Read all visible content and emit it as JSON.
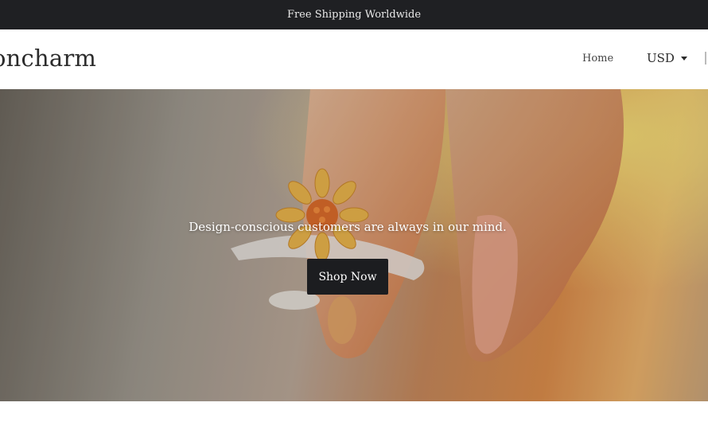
{
  "announcement": {
    "text": "Free Shipping Worldwide"
  },
  "header": {
    "logo_text": "oncharm",
    "nav": {
      "home_label": "Home"
    },
    "currency": {
      "selected": "USD",
      "icon": "chevron-down-icon"
    }
  },
  "hero": {
    "tagline": "Design-conscious customers are always in our mind.",
    "cta_label": "Shop Now",
    "image_subject": "sunflower-ring-on-finger",
    "colors": {
      "button_bg": "#1c1d20",
      "announcement_bg": "#1f2023"
    }
  }
}
